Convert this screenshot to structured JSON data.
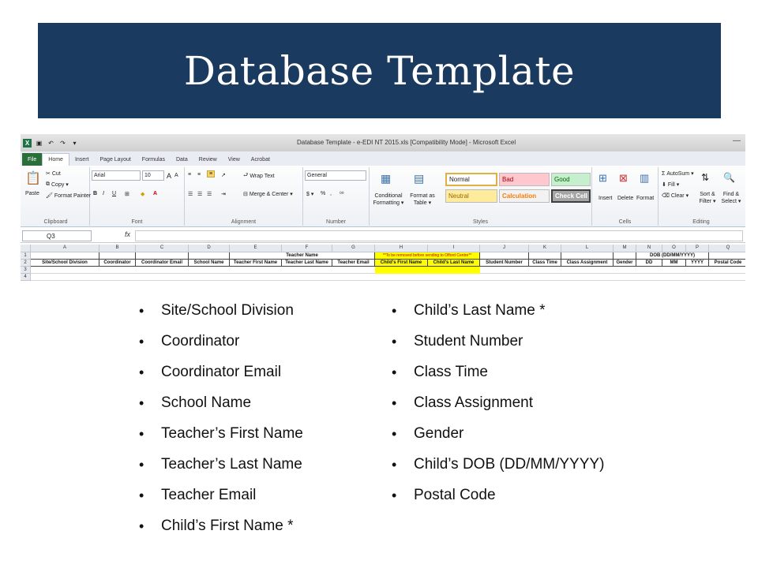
{
  "title": "Database Template",
  "excel": {
    "window_title": "Database Template - e-EDI NT 2015.xls  [Compatibility Mode]  -  Microsoft Excel",
    "tabs": [
      "File",
      "Home",
      "Insert",
      "Page Layout",
      "Formulas",
      "Data",
      "Review",
      "View",
      "Acrobat"
    ],
    "clipboard": {
      "paste": "Paste",
      "cut": "Cut",
      "copy": "Copy ▾",
      "format_painter": "Format Painter",
      "label": "Clipboard"
    },
    "font": {
      "name": "Arial",
      "size": "10",
      "label": "Font"
    },
    "alignment": {
      "wrap": "Wrap Text",
      "merge": "Merge & Center ▾",
      "label": "Alignment"
    },
    "number": {
      "format": "General",
      "label": "Number"
    },
    "styles": {
      "conditional": "Conditional Formatting ▾",
      "format_table": "Format as Table ▾",
      "normal": "Normal",
      "bad": "Bad",
      "good": "Good",
      "neutral": "Neutral",
      "calculation": "Calculation",
      "check_cell": "Check Cell",
      "label": "Styles"
    },
    "cells": {
      "insert": "Insert",
      "delete": "Delete",
      "format": "Format",
      "label": "Cells"
    },
    "editing": {
      "autosum": "AutoSum ▾",
      "fill": "Fill ▾",
      "clear": "Clear ▾",
      "sort": "Sort & Filter ▾",
      "find": "Find & Select ▾",
      "label": "Editing"
    },
    "name_box": "Q3",
    "fx": "fx",
    "columns": [
      "A",
      "B",
      "C",
      "D",
      "E",
      "F",
      "G",
      "H",
      "I",
      "J",
      "K",
      "L",
      "M",
      "N",
      "O",
      "P",
      "Q"
    ],
    "row_numbers": [
      "1",
      "2",
      "3",
      "4"
    ],
    "row1": {
      "teacher_name": "Teacher Name",
      "note": "**To be removed before sending to Offord Centre**",
      "dob": "DOB (DD/MM/YYYY)"
    },
    "row2": [
      "Site/School Division",
      "Coordinator",
      "Coordinator Email",
      "School Name",
      "Teacher First Name",
      "Teacher Last Name",
      "Teacher Email",
      "Child's First Name",
      "Child's Last Name",
      "Student Number",
      "Class Time",
      "Class Assignment",
      "Gender",
      "DD",
      "MM",
      "YYYY",
      "Postal Code"
    ],
    "highlight_color": "#ffff00"
  },
  "list_left": [
    "Site/School Division",
    "Coordinator",
    "Coordinator Email",
    "School Name",
    "Teacher’s First Name",
    "Teacher’s Last Name",
    "Teacher Email",
    "Child’s First Name *"
  ],
  "list_right": [
    "Child’s Last Name *",
    "Student Number",
    "Class Time",
    "Class Assignment",
    "Gender",
    "Child’s DOB (DD/MM/YYYY)",
    "Postal Code"
  ]
}
